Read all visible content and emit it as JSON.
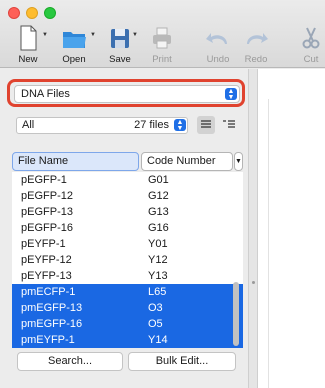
{
  "toolbar": {
    "new_label": "New",
    "open_label": "Open",
    "save_label": "Save",
    "print_label": "Print",
    "undo_label": "Undo",
    "redo_label": "Redo",
    "cut_label": "Cut"
  },
  "source": {
    "selected": "DNA Files"
  },
  "filter": {
    "selected": "All",
    "count": "27 files"
  },
  "table": {
    "columns": [
      "File Name",
      "Code Number"
    ],
    "rows": [
      {
        "name": "pEGFP-1",
        "code": "G01",
        "selected": false
      },
      {
        "name": "pEGFP-12",
        "code": "G12",
        "selected": false
      },
      {
        "name": "pEGFP-13",
        "code": "G13",
        "selected": false
      },
      {
        "name": "pEGFP-16",
        "code": "G16",
        "selected": false
      },
      {
        "name": "pEYFP-1",
        "code": "Y01",
        "selected": false
      },
      {
        "name": "pEYFP-12",
        "code": "Y12",
        "selected": false
      },
      {
        "name": "pEYFP-13",
        "code": "Y13",
        "selected": false
      },
      {
        "name": "pmECFP-1",
        "code": "L65",
        "selected": true
      },
      {
        "name": "pmEGFP-13",
        "code": "O3",
        "selected": true
      },
      {
        "name": "pmEGFP-16",
        "code": "O5",
        "selected": true
      },
      {
        "name": "pmEYFP-1",
        "code": "Y14",
        "selected": true
      }
    ]
  },
  "buttons": {
    "search_label": "Search...",
    "bulk_edit_label": "Bulk Edit..."
  },
  "colors": {
    "selection": "#1a68e3",
    "highlight": "#e0432f",
    "accent": "#1f6fe6"
  }
}
